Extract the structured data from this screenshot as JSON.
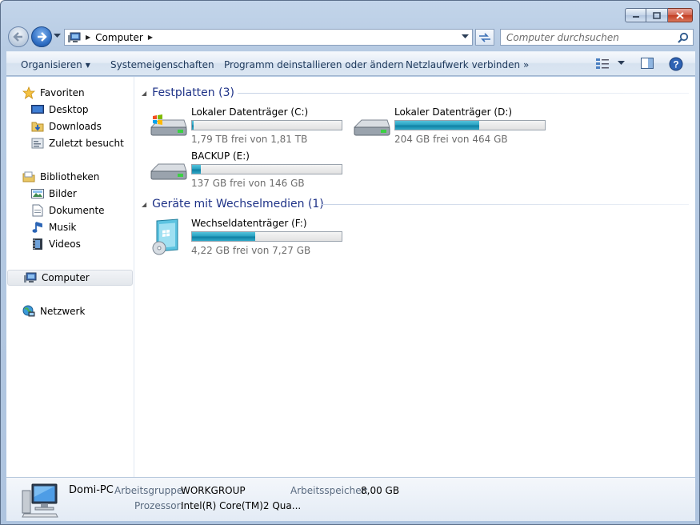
{
  "window": {
    "controls": {
      "minimize": "minimize",
      "maximize": "maximize",
      "close": "close"
    }
  },
  "address": {
    "crumb": "Computer",
    "search_placeholder": "Computer durchsuchen"
  },
  "toolbar": {
    "organize": "Organisieren",
    "system_properties": "Systemeigenschaften",
    "uninstall": "Programm deinstallieren oder ändern",
    "map_drive": "Netzlaufwerk verbinden",
    "more": "»"
  },
  "nav": {
    "favorites": {
      "label": "Favoriten",
      "items": [
        "Desktop",
        "Downloads",
        "Zuletzt besucht"
      ]
    },
    "libraries": {
      "label": "Bibliotheken",
      "items": [
        "Bilder",
        "Dokumente",
        "Musik",
        "Videos"
      ]
    },
    "computer": "Computer",
    "network": "Netzwerk"
  },
  "groups": {
    "hard_disks": {
      "title": "Festplatten (3)",
      "drives": [
        {
          "name": "Lokaler Datenträger (C:)",
          "free": "1,79 TB frei von 1,81 TB",
          "used_fraction": 0.01
        },
        {
          "name": "Lokaler Datenträger (D:)",
          "free": "204 GB frei von 464 GB",
          "used_fraction": 0.56
        },
        {
          "name": "BACKUP (E:)",
          "free": "137 GB frei von 146 GB",
          "used_fraction": 0.06
        }
      ]
    },
    "removable": {
      "title": "Geräte mit Wechselmedien (1)",
      "drives": [
        {
          "name": "Wechseldatenträger (F:)",
          "free": "4,22 GB frei von 7,27 GB",
          "used_fraction": 0.42
        }
      ]
    }
  },
  "details": {
    "pc_name": "Domi-PC",
    "workgroup_label": "Arbeitsgruppe:",
    "workgroup": "WORKGROUP",
    "memory_label": "Arbeitsspeicher:",
    "memory": "8,00 GB",
    "cpu_label": "Prozessor:",
    "cpu": "Intel(R) Core(TM)2 Qua..."
  },
  "colors": {
    "accent": "#1e3287",
    "bar_fill": "#2aa2c2",
    "window_frame": "#b7cbe3"
  }
}
